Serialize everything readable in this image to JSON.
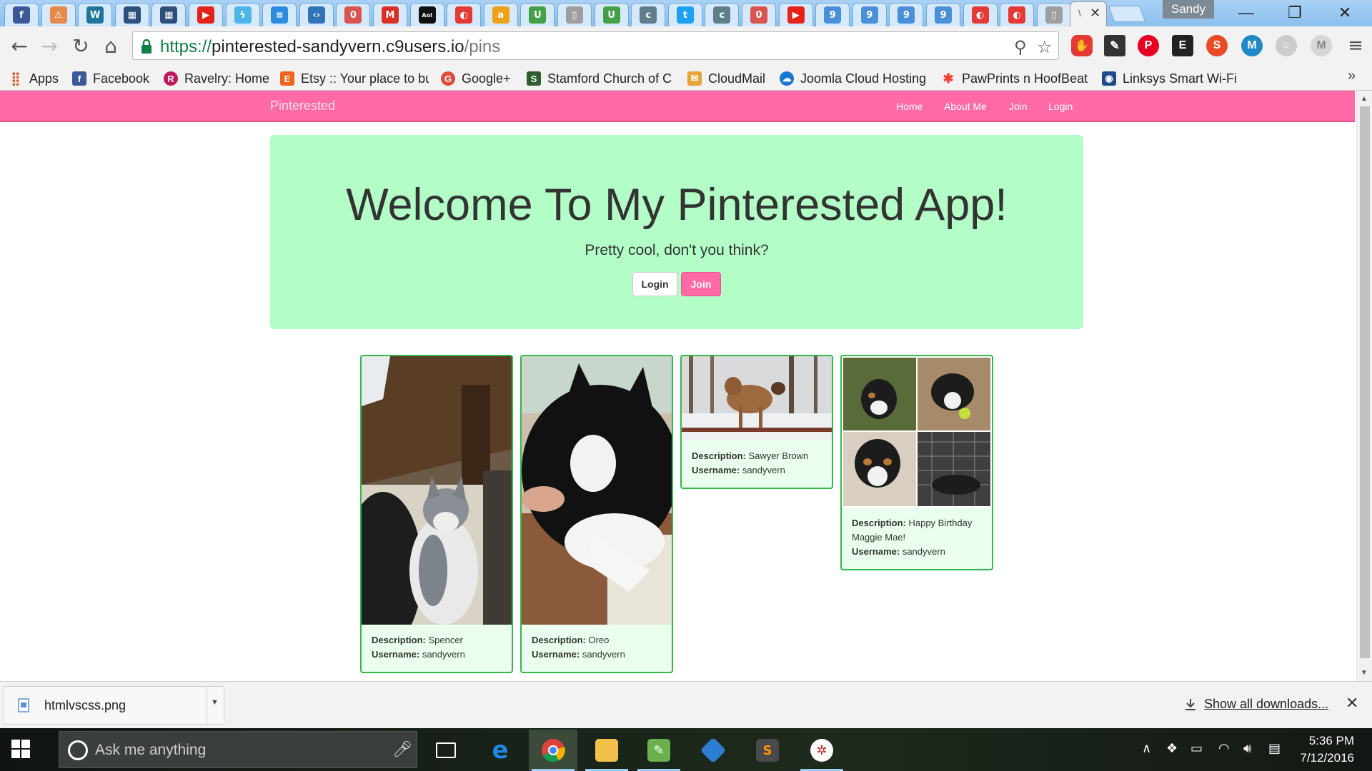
{
  "browser": {
    "profile_name": "Sandy",
    "active_tab_title": "\\",
    "url": {
      "scheme": "https://",
      "host": "pinterested-sandyvern.c9users.io",
      "path": "/pins"
    },
    "tab_favicons": [
      {
        "icon": "facebook-icon",
        "glyph": "f",
        "color": "#3b5998"
      },
      {
        "icon": "warning-icon",
        "glyph": "⚠",
        "color": "#e8894c"
      },
      {
        "icon": "wordpress-icon",
        "glyph": "W",
        "color": "#21759b"
      },
      {
        "icon": "site-icon",
        "glyph": "▦",
        "color": "#2c4f7c"
      },
      {
        "icon": "site-icon",
        "glyph": "▦",
        "color": "#2c4f7c"
      },
      {
        "icon": "youtube-icon",
        "glyph": "▶",
        "color": "#e62117"
      },
      {
        "icon": "lightning-icon",
        "glyph": "ϟ",
        "color": "#4db6e8"
      },
      {
        "icon": "lines-icon",
        "glyph": "≡",
        "color": "#2e8ce0"
      },
      {
        "icon": "code-icon",
        "glyph": "‹›",
        "color": "#3073b8"
      },
      {
        "icon": "badge-icon",
        "glyph": "0",
        "color": "#d9534f"
      },
      {
        "icon": "gmail-icon",
        "glyph": "M",
        "color": "#d93025"
      },
      {
        "icon": "aol-icon",
        "glyph": "Aol",
        "color": "#111111"
      },
      {
        "icon": "app-icon",
        "glyph": "◐",
        "color": "#e53935"
      },
      {
        "icon": "amazon-icon",
        "glyph": "a",
        "color": "#f0a11a"
      },
      {
        "icon": "u-icon",
        "glyph": "U",
        "color": "#43a047"
      },
      {
        "icon": "page-icon",
        "glyph": "▯",
        "color": "#9e9e9e"
      },
      {
        "icon": "u-icon",
        "glyph": "U",
        "color": "#43a047"
      },
      {
        "icon": "c-icon",
        "glyph": "c",
        "color": "#607d8b"
      },
      {
        "icon": "twitter-icon",
        "glyph": "t",
        "color": "#1da1f2"
      },
      {
        "icon": "c-icon",
        "glyph": "c",
        "color": "#607d8b"
      },
      {
        "icon": "badge-icon",
        "glyph": "0",
        "color": "#d9534f"
      },
      {
        "icon": "youtube-icon",
        "glyph": "▶",
        "color": "#e62117"
      },
      {
        "icon": "c9-icon",
        "glyph": "9",
        "color": "#4a90d9"
      },
      {
        "icon": "c9-icon",
        "glyph": "9",
        "color": "#4a90d9"
      },
      {
        "icon": "c9-icon",
        "glyph": "9",
        "color": "#4a90d9"
      },
      {
        "icon": "c9-icon",
        "glyph": "9",
        "color": "#4a90d9"
      },
      {
        "icon": "app-icon",
        "glyph": "◐",
        "color": "#e53935"
      },
      {
        "icon": "app-icon",
        "glyph": "◐",
        "color": "#e53935"
      },
      {
        "icon": "page-icon",
        "glyph": "▯",
        "color": "#9e9e9e"
      }
    ],
    "bookmarks": [
      {
        "label": "Apps",
        "icon": "apps-grid-icon",
        "glyph": "⣿",
        "color": "#e0592a"
      },
      {
        "label": "Facebook",
        "icon": "facebook-icon",
        "glyph": "f",
        "color": "#3b5998"
      },
      {
        "label": "Ravelry: Home",
        "icon": "ravelry-icon",
        "glyph": "R",
        "color": "#c2185b"
      },
      {
        "label": "Etsy :: Your place to bu",
        "icon": "etsy-icon",
        "glyph": "E",
        "color": "#f1641e"
      },
      {
        "label": "Google+",
        "icon": "google-plus-icon",
        "glyph": "G",
        "color": "#dd4b39"
      },
      {
        "label": "Stamford Church of C",
        "icon": "s-icon",
        "glyph": "S",
        "color": "#2e5e2e"
      },
      {
        "label": "CloudMail",
        "icon": "mail-icon",
        "glyph": "✉",
        "color": "#e8a33a"
      },
      {
        "label": "Joomla Cloud Hosting",
        "icon": "cloud-icon",
        "glyph": "☁",
        "color": "#1976d2"
      },
      {
        "label": "PawPrints n HoofBeat",
        "icon": "joomla-icon",
        "glyph": "✱",
        "color": "#f44336"
      },
      {
        "label": "Linksys Smart Wi-Fi",
        "icon": "wifi-icon",
        "glyph": "◉",
        "color": "#1e4a8a"
      }
    ]
  },
  "site": {
    "brand": "Pinterested",
    "nav": [
      "Home",
      "About Me",
      "Join",
      "Login"
    ],
    "jumbotron": {
      "title": "Welcome To My Pinterested App!",
      "subtitle": "Pretty cool, don't you think?",
      "login_label": "Login",
      "join_label": "Join"
    },
    "pins": [
      {
        "description": "Spencer",
        "username": "sandyvern"
      },
      {
        "description": "Oreo",
        "username": "sandyvern"
      },
      {
        "description": "Sawyer Brown",
        "username": "sandyvern"
      },
      {
        "description": "Happy Birthday Maggie Mae!",
        "username": "sandyvern"
      }
    ],
    "labels": {
      "description": "Description:",
      "username": "Username:"
    }
  },
  "downloads": {
    "file_name": "htmlvscss.png",
    "show_all": "Show all downloads..."
  },
  "taskbar": {
    "search_placeholder": "Ask me anything",
    "time": "5:36 PM",
    "date": "7/12/2016"
  },
  "colors": {
    "nav_pink": "#ff69a5",
    "jumbotron_green": "#b3fec7",
    "pin_border": "#2fba4a",
    "pin_background": "#eaffee"
  }
}
